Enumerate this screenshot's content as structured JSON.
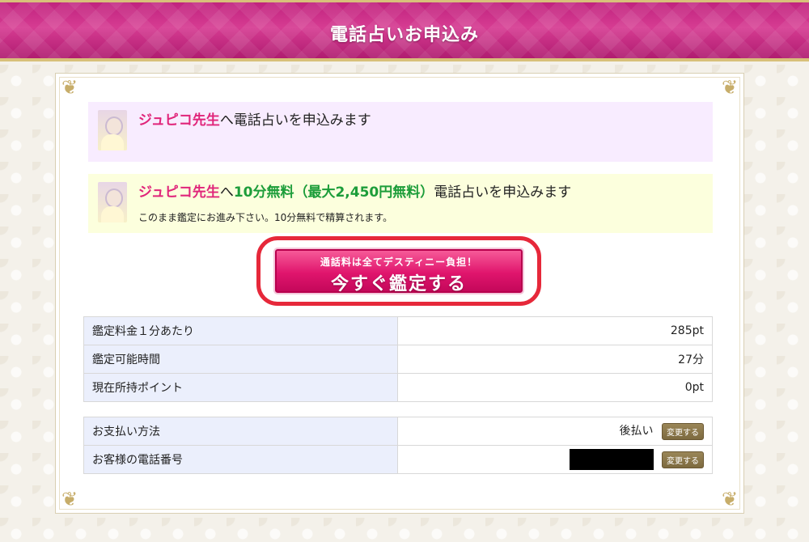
{
  "header": {
    "title": "電話占いお申込み"
  },
  "notice_pink": {
    "teacher": "ジュピコ先生",
    "text": "へ電話占いを申込みます"
  },
  "notice_yellow": {
    "teacher": "ジュピコ先生",
    "connector": "へ",
    "free_text": "10分無料（最大2,450円無料）",
    "text": "電話占いを申込みます",
    "sub": "このまま鑑定にお進み下さい。10分無料で精算されます。"
  },
  "cta": {
    "small": "通話料は全てデスティニー負担！",
    "main": "今すぐ鑑定する",
    "highlight_color": "#e6283a"
  },
  "info_table": [
    {
      "label": "鑑定料金１分あたり",
      "value": "285pt"
    },
    {
      "label": "鑑定可能時間",
      "value": "27分"
    },
    {
      "label": "現在所持ポイント",
      "value": "0pt"
    }
  ],
  "account_table": {
    "payment_label": "お支払い方法",
    "payment_value": "後払い",
    "phone_label": "お客様の電話番号",
    "change_label": "変更する"
  },
  "colors": {
    "header": "#c0237e",
    "accent_pink": "#e0257a",
    "accent_green": "#1d9d3a"
  }
}
